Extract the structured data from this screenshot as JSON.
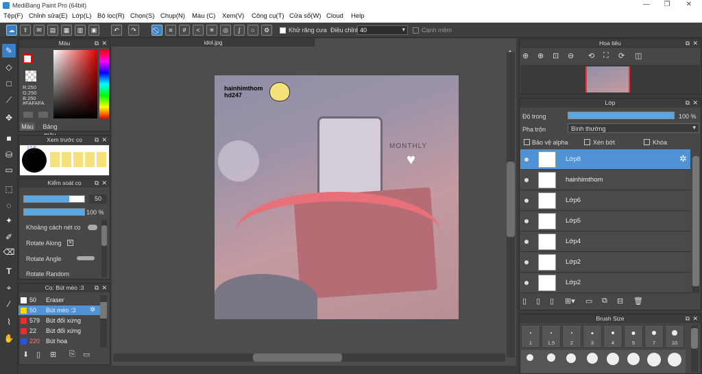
{
  "window": {
    "title": "MediBang Paint Pro (64bit)"
  },
  "menu": [
    "Tệp(F)",
    "Chỉnh sửa(E)",
    "Lớp(L)",
    "Bộ lọc(R)",
    "Chọn(S)",
    "Chụp(N)",
    "Màu (C)",
    "Xem(V)",
    "Công cụ(T)",
    "Cửa sổ(W)",
    "Cloud",
    "Help"
  ],
  "toolbar": {
    "antialias": "Khử răng cưa",
    "adjust": "Điều chỉnh",
    "adjust_value": "40",
    "smooth": "Cạnh mềm"
  },
  "color_panel": {
    "title": "Màu",
    "r": "R:250",
    "g": "G:250",
    "b": "B:250",
    "hex": "#FAFAFA",
    "tab1": "Màu",
    "tab2": "Bảng màu"
  },
  "preview_panel": {
    "title": "Xem trước cọ",
    "size": "17.6"
  },
  "brush_control": {
    "title": "Kiểm soát cọ",
    "size": "50",
    "opacity": "100 %",
    "spacing": "Khoảng cách nét cọ",
    "rotate_along": "Rotate Along",
    "rotate_angle": "Rotate Angle",
    "rotate_random": "Rotate Random"
  },
  "brush_list": {
    "title": "Cọ: Bút mèo :3",
    "items": [
      {
        "size": "50",
        "name": "Eraser",
        "color": "#ffffff"
      },
      {
        "size": "50",
        "name": "Bút mèo :3",
        "color": "#f5d90a"
      },
      {
        "size": "579",
        "name": "Bút đối xứng",
        "color": "#e03030"
      },
      {
        "size": "22",
        "name": "Bút đối xứng",
        "color": "#e03030"
      },
      {
        "size": "220",
        "name": "Bút hoa",
        "color": "#3050e0"
      }
    ]
  },
  "canvas": {
    "tab": "idol.jpg",
    "text1": "hainhimthom",
    "text2": "hd247",
    "planner": "MONTHLY"
  },
  "navigator": {
    "title": "Hoa tiêu"
  },
  "layers": {
    "title": "Lớp",
    "opacity_label": "Độ trong",
    "opacity_value": "100 %",
    "blend_label": "Pha trộn",
    "blend_value": "Bình thường",
    "protect": "Bảo vệ alpha",
    "clip": "Xén bớt",
    "lock": "Khóa",
    "items": [
      "Lớp8",
      "hainhimthom",
      "Lớp6",
      "Lớp5",
      "Lớp4",
      "Lớp2",
      "Lớp2"
    ]
  },
  "brush_size": {
    "title": "Brush Size",
    "sizes": [
      "1",
      "1.5",
      "2",
      "3",
      "4",
      "5",
      "7",
      "10"
    ]
  }
}
